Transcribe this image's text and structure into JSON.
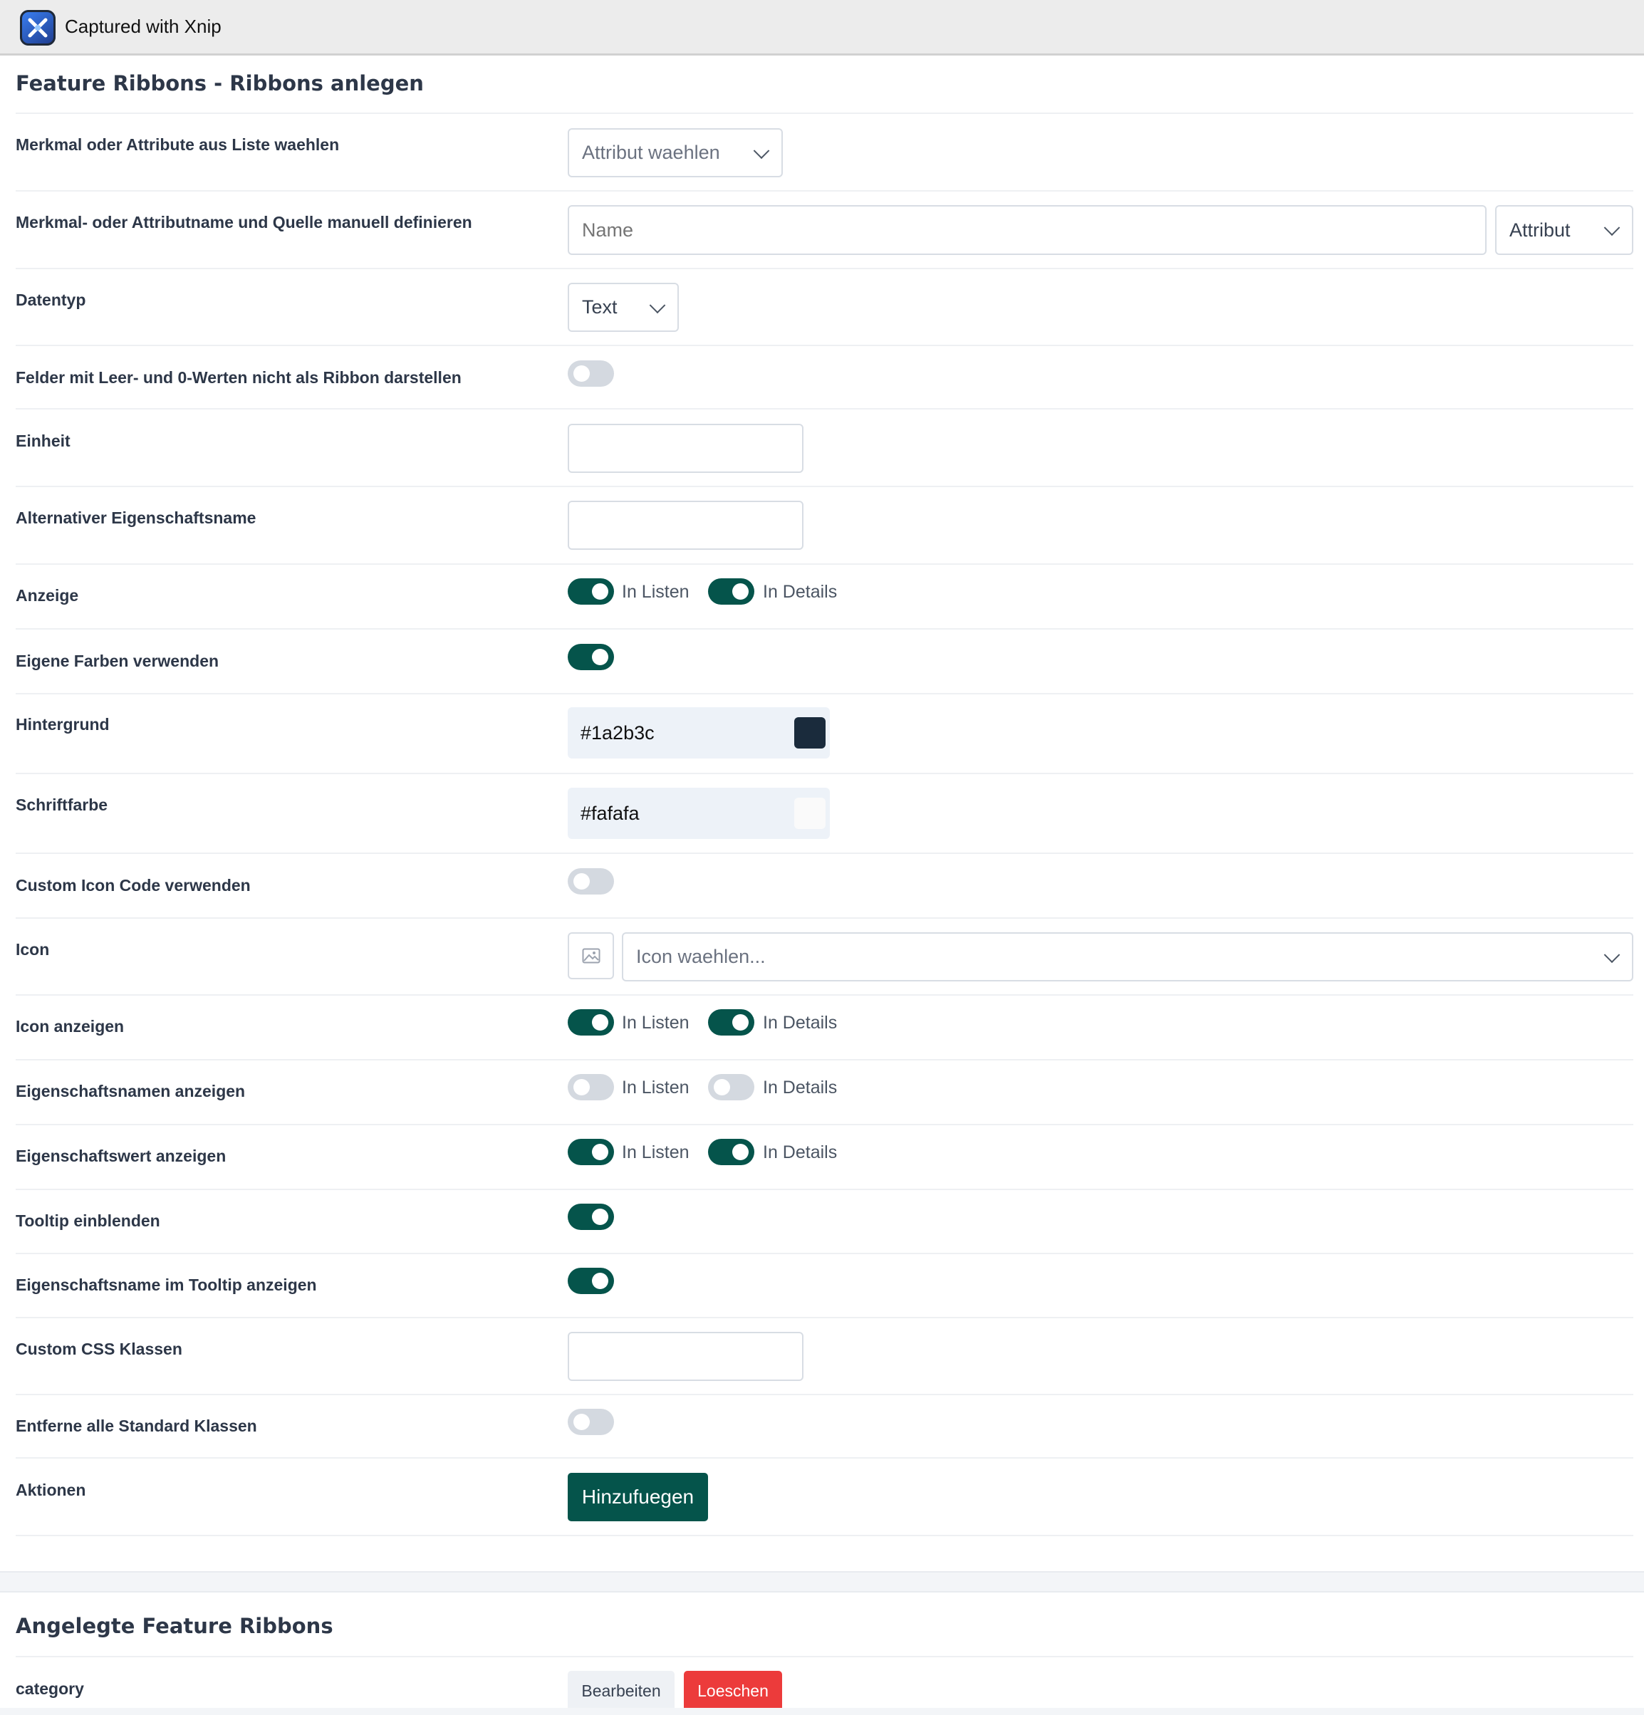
{
  "window": {
    "title": "Captured with Xnip"
  },
  "form": {
    "title": "Feature Ribbons - Ribbons anlegen",
    "rows": {
      "attr_select": {
        "label": "Merkmal oder Attribute aus Liste waehlen",
        "value": "Attribut waehlen"
      },
      "manual": {
        "label": "Merkmal- oder Attributname und Quelle manuell definieren",
        "name_placeholder": "Name",
        "source_value": "Attribut"
      },
      "datatype": {
        "label": "Datentyp",
        "value": "Text"
      },
      "hide_empty": {
        "label": "Felder mit Leer- und 0-Werten nicht als Ribbon darstellen",
        "on": false
      },
      "unit": {
        "label": "Einheit",
        "value": ""
      },
      "alt_name": {
        "label": "Alternativer Eigenschaftsname",
        "value": ""
      },
      "display": {
        "label": "Anzeige",
        "list_label": "In Listen",
        "details_label": "In Details",
        "list_on": true,
        "details_on": true
      },
      "own_colors": {
        "label": "Eigene Farben verwenden",
        "on": true
      },
      "background": {
        "label": "Hintergrund",
        "value": "#1a2b3c",
        "swatch": "#1a2b3c"
      },
      "font_color": {
        "label": "Schriftfarbe",
        "value": "#fafafa",
        "swatch": "#fafafa"
      },
      "custom_icon": {
        "label": "Custom Icon Code verwenden",
        "on": false
      },
      "icon": {
        "label": "Icon",
        "placeholder": "Icon waehlen..."
      },
      "icon_show": {
        "label": "Icon anzeigen",
        "list_label": "In Listen",
        "details_label": "In Details",
        "list_on": true,
        "details_on": true
      },
      "prop_names": {
        "label": "Eigenschaftsnamen anzeigen",
        "list_label": "In Listen",
        "details_label": "In Details",
        "list_on": false,
        "details_on": false
      },
      "prop_value": {
        "label": "Eigenschaftswert anzeigen",
        "list_label": "In Listen",
        "details_label": "In Details",
        "list_on": true,
        "details_on": true
      },
      "tooltip": {
        "label": "Tooltip einblenden",
        "on": true
      },
      "tooltip_name": {
        "label": "Eigenschaftsname im Tooltip anzeigen",
        "on": true
      },
      "css": {
        "label": "Custom CSS Klassen",
        "value": ""
      },
      "remove_std": {
        "label": "Entferne alle Standard Klassen",
        "on": false
      },
      "actions": {
        "label": "Aktionen",
        "add_label": "Hinzufuegen"
      }
    }
  },
  "created": {
    "title": "Angelegte Feature Ribbons",
    "items": [
      {
        "name": "category",
        "edit_label": "Bearbeiten",
        "delete_label": "Loeschen"
      }
    ]
  },
  "icons": {
    "app": "xnip-app-icon",
    "chevron": "chevron-down-icon",
    "image": "image-placeholder-icon"
  },
  "colors": {
    "accent": "#05544b",
    "danger": "#ec3b3b",
    "toggle_off": "#d4d9e0"
  }
}
